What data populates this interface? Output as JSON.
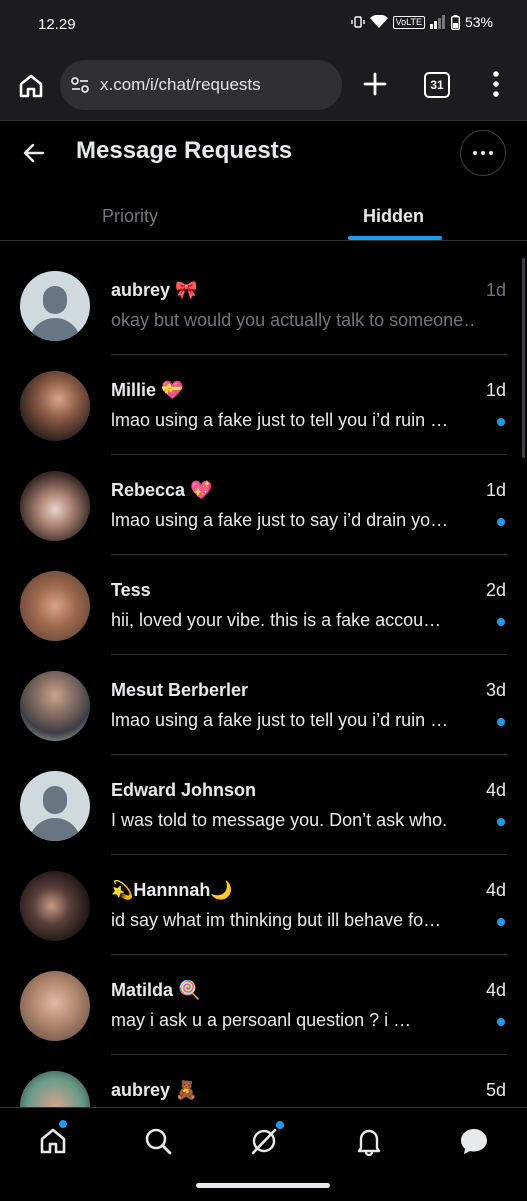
{
  "status_bar": {
    "time": "12.29",
    "network_badge": "VoLTE",
    "battery": "53%"
  },
  "browser": {
    "url": "x.com/i/chat/requests",
    "tab_count": "31"
  },
  "header": {
    "title": "Message Requests"
  },
  "tabs": [
    {
      "label": "Priority",
      "active": false
    },
    {
      "label": "Hidden",
      "active": true
    }
  ],
  "requests": [
    {
      "name": "aubrey 🎀",
      "time": "1d",
      "message": "okay but would you actually talk to someone…",
      "unread": false,
      "avatar": "default-avatar"
    },
    {
      "name": "Millie 💝",
      "time": "1d",
      "message": "lmao using a fake just to tell you i’d ruin …",
      "unread": true,
      "avatar": "photo-avatar"
    },
    {
      "name": "Rebecca 💖",
      "time": "1d",
      "message": "lmao using a fake just to say i’d drain yo…",
      "unread": true,
      "avatar": "photo-avatar"
    },
    {
      "name": "Tess",
      "time": "2d",
      "message": "hii, loved your vibe. this is a fake accou…",
      "unread": true,
      "avatar": "photo-avatar"
    },
    {
      "name": "Mesut Berberler",
      "time": "3d",
      "message": "lmao using a fake just to tell you i’d ruin …",
      "unread": true,
      "avatar": "photo-avatar"
    },
    {
      "name": "Edward Johnson",
      "time": "4d",
      "message": "I was told to message you. Don’t ask who.",
      "unread": true,
      "avatar": "default-avatar"
    },
    {
      "name": "💫Hannnah🌙",
      "time": "4d",
      "message": "id say what im thinking but ill behave fo…",
      "unread": true,
      "avatar": "photo-avatar"
    },
    {
      "name": "Matilda 🍭",
      "time": "4d",
      "message": "may i ask u a persoanl question ? i …",
      "unread": true,
      "avatar": "photo-avatar"
    },
    {
      "name": "aubrey 🧸",
      "time": "5d",
      "message": "",
      "unread": false,
      "avatar": "photo-avatar"
    }
  ],
  "bottom_nav": [
    {
      "icon": "home-icon",
      "badge": true
    },
    {
      "icon": "search-icon",
      "badge": false
    },
    {
      "icon": "grok-icon",
      "badge": true
    },
    {
      "icon": "bell-icon",
      "badge": false
    },
    {
      "icon": "chat-bubble-icon",
      "badge": false,
      "active": true
    }
  ],
  "colors": {
    "accent": "#1d9bf0",
    "background": "#000000",
    "text_primary": "#e7e9ea",
    "text_secondary": "#71767b"
  }
}
